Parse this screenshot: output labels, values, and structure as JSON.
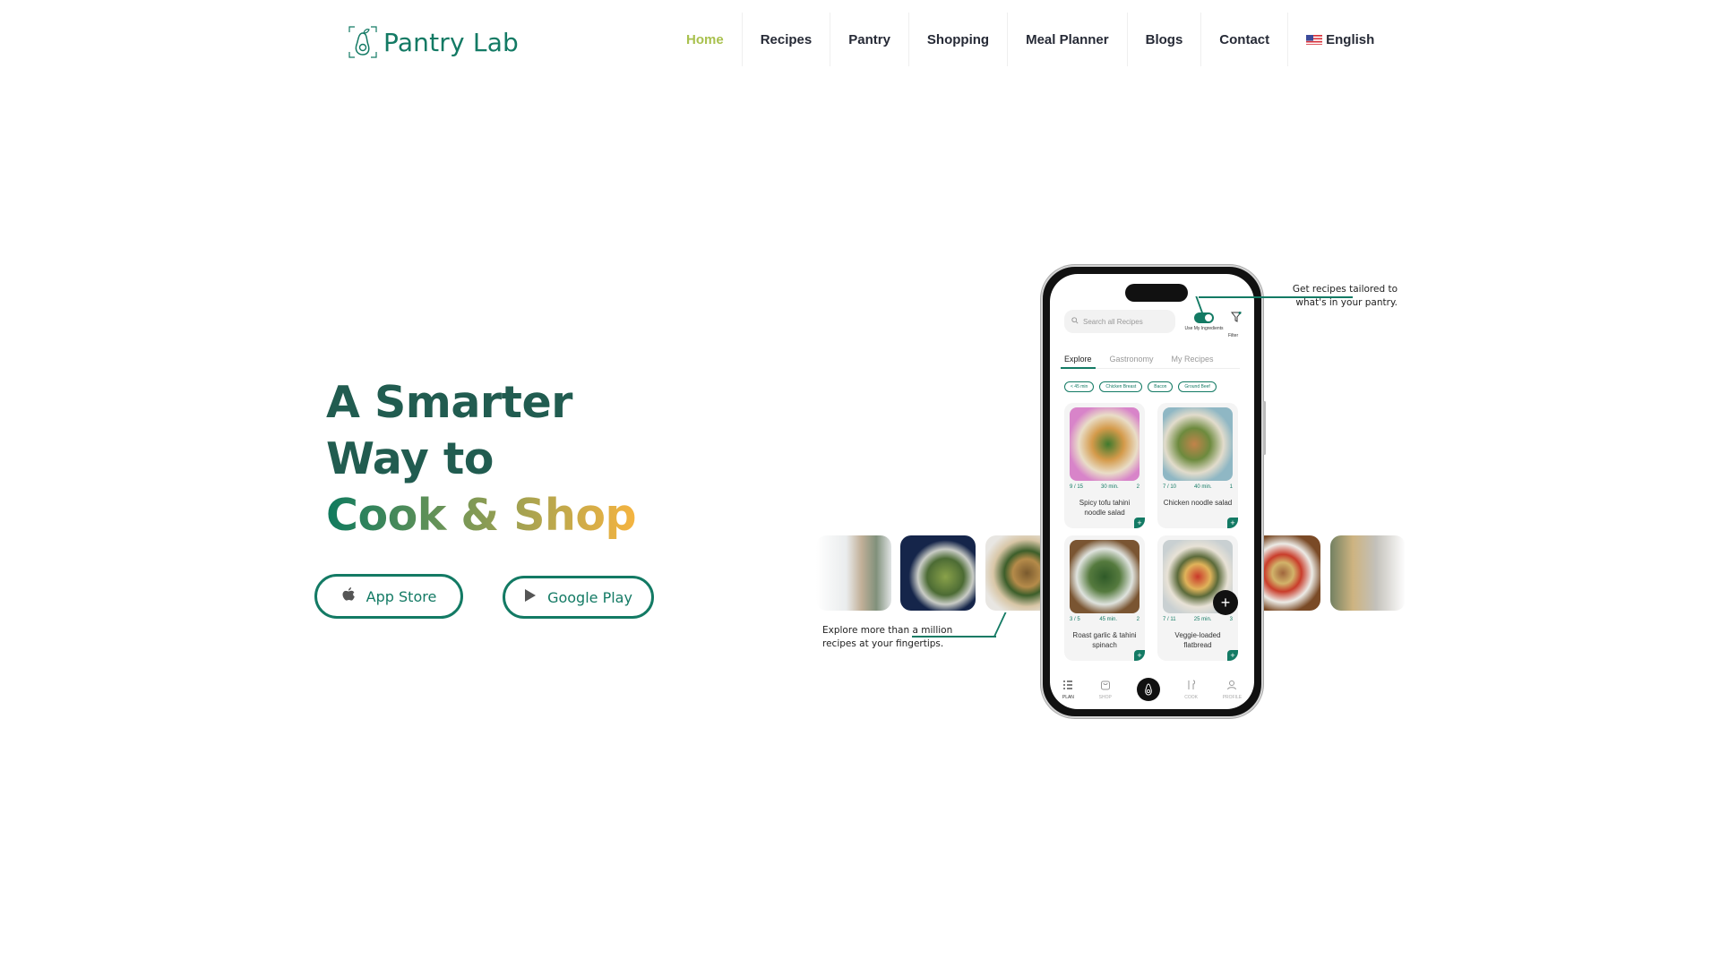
{
  "brand": {
    "name": "Pantry Lab",
    "primary_color": "#137a64",
    "accent_color": "#a9c14e"
  },
  "nav": {
    "items": [
      {
        "label": "Home",
        "active": true
      },
      {
        "label": "Recipes",
        "active": false
      },
      {
        "label": "Pantry",
        "active": false
      },
      {
        "label": "Shopping",
        "active": false
      },
      {
        "label": "Meal Planner",
        "active": false
      },
      {
        "label": "Blogs",
        "active": false
      },
      {
        "label": "Contact",
        "active": false
      }
    ],
    "language": {
      "label": "English",
      "icon": "us-flag-icon"
    }
  },
  "hero": {
    "line1": "A Smarter",
    "line2": "Way to",
    "line3": "Cook & Shop",
    "buttons": {
      "app_store": {
        "label": "App Store",
        "icon": "apple-icon"
      },
      "google_play": {
        "label": "Google Play",
        "icon": "play-icon"
      }
    }
  },
  "phone": {
    "search_placeholder": "Search all Recipes",
    "toggle_label": "Use My Ingredients",
    "filter_label": "Filter",
    "tabs": [
      "Explore",
      "Gastronomy",
      "My Recipes"
    ],
    "chips": [
      "< 45 min",
      "Chicken Breast",
      "Bacon",
      "Ground Beef"
    ],
    "cards": [
      {
        "name": "Spicy tofu tahini noodle salad",
        "match": "9 / 15",
        "time": "30 min.",
        "count": "2"
      },
      {
        "name": "Chicken noodle salad",
        "match": "7 / 10",
        "time": "40 min.",
        "count": "1"
      },
      {
        "name": "Roast garlic & tahini spinach",
        "match": "3 / 5",
        "time": "45 min.",
        "count": "2"
      },
      {
        "name": "Veggie-loaded flatbread",
        "match": "7 / 11",
        "time": "25 min.",
        "count": "3"
      }
    ],
    "bottom_nav": [
      "PLAN",
      "SHOP",
      "",
      "COOK",
      "PROFILE"
    ],
    "add_symbol": "+"
  },
  "annotations": {
    "top": "Get recipes tailored to what's in your pantry.",
    "bottom_prefix": "Explore more than ",
    "bottom_underlined": "a million",
    "bottom_suffix": "recipes at your fingertips."
  }
}
